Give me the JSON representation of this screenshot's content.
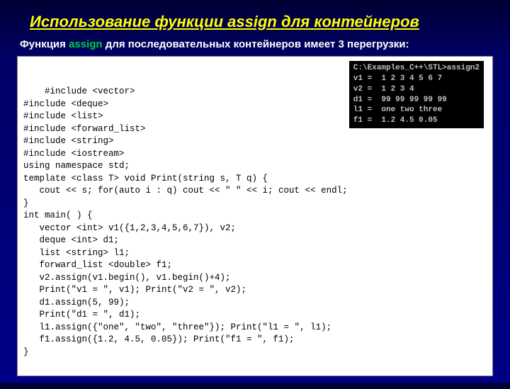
{
  "title": "Использование функции assign для контейнеров",
  "subtitle_prefix": "Функция ",
  "subtitle_green": "assign",
  "subtitle_rest": " для последовательных контейнеров имеет 3 перегрузки:",
  "code": "#include <vector>\n#include <deque>\n#include <list>\n#include <forward_list>\n#include <string>\n#include <iostream>\nusing namespace std;\ntemplate <class T> void Print(string s, T q) {\n   cout << s; for(auto i : q) cout << \" \" << i; cout << endl;\n}\nint main( ) {\n   vector <int> v1({1,2,3,4,5,6,7}), v2;\n   deque <int> d1;\n   list <string> l1;\n   forward_list <double> f1;\n   v2.assign(v1.begin(), v1.begin()+4);\n   Print(\"v1 = \", v1); Print(\"v2 = \", v2);\n   d1.assign(5, 99);\n   Print(\"d1 = \", d1);\n   l1.assign({\"one\", \"two\", \"three\"}); Print(\"l1 = \", l1);\n   f1.assign({1.2, 4.5, 0.05}); Print(\"f1 = \", f1);\n}",
  "console": "C:\\Examples_C++\\STL>assign2\nv1 =  1 2 3 4 5 6 7\nv2 =  1 2 3 4\nd1 =  99 99 99 99 99\nl1 =  one two three\nf1 =  1.2 4.5 0.05"
}
